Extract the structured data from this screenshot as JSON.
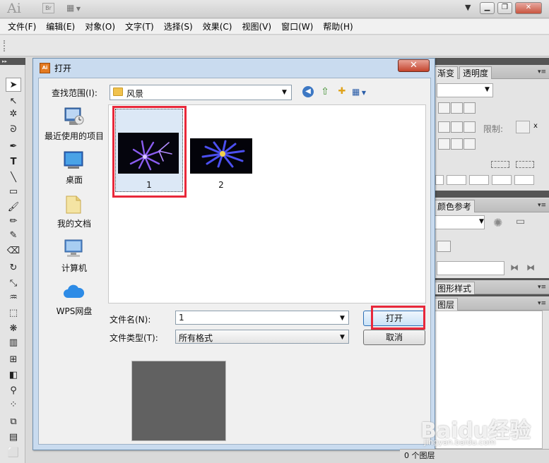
{
  "app": {
    "logo": "Ai",
    "bridge": "Br"
  },
  "menu": [
    "文件(F)",
    "编辑(E)",
    "对象(O)",
    "文字(T)",
    "选择(S)",
    "效果(C)",
    "视图(V)",
    "窗口(W)",
    "帮助(H)"
  ],
  "window_buttons": {
    "minimize": "▁",
    "restore": "❐",
    "close": "✕"
  },
  "dialog": {
    "title": "打开",
    "close_glyph": "✕",
    "look_in_label": "查找范围(I):",
    "look_in_value": "风景",
    "places": [
      {
        "label": "最近使用的项目",
        "icon": "recent-items-icon"
      },
      {
        "label": "桌面",
        "icon": "desktop-icon"
      },
      {
        "label": "我的文档",
        "icon": "documents-icon"
      },
      {
        "label": "计算机",
        "icon": "computer-icon"
      },
      {
        "label": "WPS网盘",
        "icon": "cloud-icon"
      }
    ],
    "files": [
      {
        "name": "1",
        "selected": true
      },
      {
        "name": "2",
        "selected": false
      }
    ],
    "file_name_label": "文件名(N):",
    "file_name_value": "1",
    "file_type_label": "文件类型(T):",
    "file_type_value": "所有格式",
    "open_button": "打开",
    "cancel_button": "取消"
  },
  "right_panels": {
    "tab_gradient": "渐变",
    "tab_transparency": "透明度",
    "limit_label": "限制:",
    "color_guide": "颜色参考",
    "graphic_styles": "图形样式",
    "layers": "图层",
    "layers_count": "0 个图层"
  },
  "watermark": {
    "text": "Baidu经验",
    "url": "jingyan.baidu.com"
  },
  "colors": {
    "highlight": "#e8283a",
    "dialog_frame": "#c9dbef"
  }
}
